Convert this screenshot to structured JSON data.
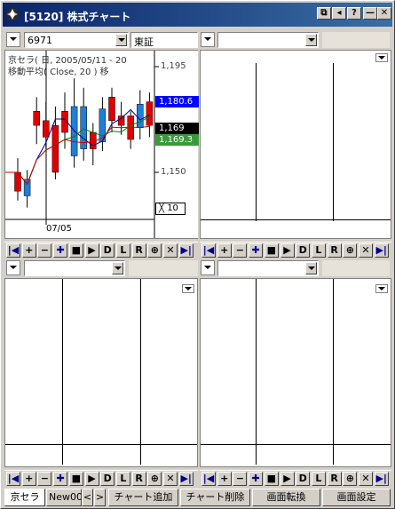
{
  "window": {
    "title": "[5120] 株式チャート",
    "controls": [
      "restore",
      "back",
      "help",
      "minimize",
      "close"
    ],
    "control_glyphs": [
      "⧉",
      "◂",
      "?",
      "—",
      "✕"
    ]
  },
  "chart1": {
    "code": "6971",
    "market": "東証",
    "legend_line1": "京セラ( 日, 2005/05/11 - 20",
    "legend_line2": "移動平均( Close, 20 )   移",
    "y_ticks": [
      "1,195",
      "1,150"
    ],
    "price_red": "1,169",
    "price_blue": "1,180.6",
    "price_green": "1,169.3",
    "zoom_label": "╳ 10",
    "x_label": "07/05",
    "colors": {
      "up": "#e00000",
      "down": "#1e7fd6",
      "ma1": "#00008b",
      "ma2": "#008000",
      "ma3": "#d00000"
    }
  },
  "nav_buttons": [
    "|◀",
    "+",
    "−",
    "✚",
    "■",
    "▶",
    "D",
    "L",
    "R",
    "⊕",
    "✕",
    "▶|"
  ],
  "bottom_bar": {
    "tabs": [
      "京セラ",
      "New00("
    ],
    "scroll_left": "<",
    "scroll_right": ">",
    "buttons": [
      "チャート追加",
      "チャート削除",
      "画面転換",
      "画面設定"
    ]
  },
  "chart_data": {
    "type": "candlestick",
    "x_label": "07/05",
    "y_ticks": [
      1195,
      1150
    ],
    "candles": [
      {
        "o": 1142,
        "c": 1150,
        "h": 1156,
        "l": 1138
      },
      {
        "o": 1147,
        "c": 1140,
        "h": 1151,
        "l": 1135
      },
      {
        "o": 1170,
        "c": 1176,
        "h": 1182,
        "l": 1162
      },
      {
        "o": 1165,
        "c": 1172,
        "h": 1180,
        "l": 1160
      },
      {
        "o": 1150,
        "c": 1170,
        "h": 1178,
        "l": 1147
      },
      {
        "o": 1167,
        "c": 1176,
        "h": 1184,
        "l": 1160
      },
      {
        "o": 1178,
        "c": 1157,
        "h": 1190,
        "l": 1152
      },
      {
        "o": 1178,
        "c": 1160,
        "h": 1186,
        "l": 1155
      },
      {
        "o": 1160,
        "c": 1167,
        "h": 1171,
        "l": 1153
      },
      {
        "o": 1177,
        "c": 1163,
        "h": 1182,
        "l": 1159
      },
      {
        "o": 1172,
        "c": 1182,
        "h": 1186,
        "l": 1167
      },
      {
        "o": 1170,
        "c": 1174,
        "h": 1180,
        "l": 1166
      },
      {
        "o": 1164,
        "c": 1174,
        "h": 1176,
        "l": 1160
      },
      {
        "o": 1179,
        "c": 1169,
        "h": 1185,
        "l": 1164
      },
      {
        "o": 1170,
        "c": 1180,
        "h": 1184,
        "l": 1165
      }
    ]
  }
}
